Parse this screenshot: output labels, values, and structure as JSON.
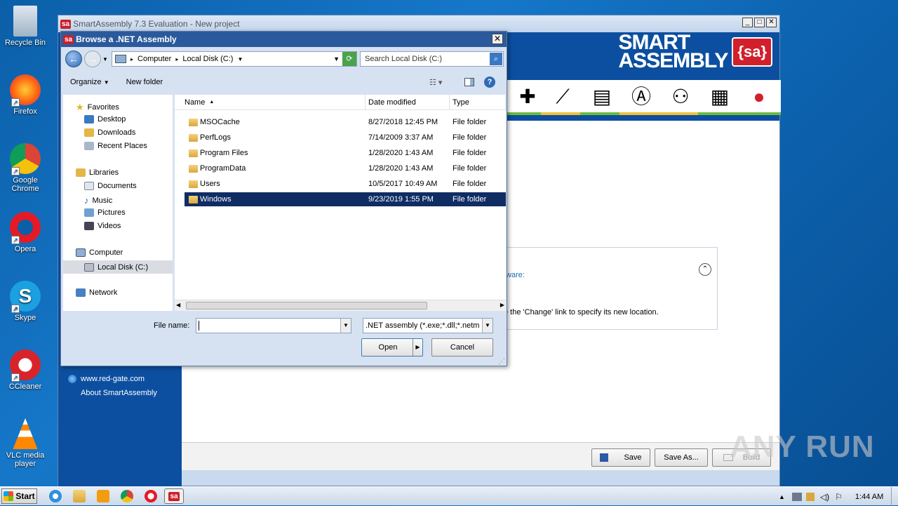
{
  "desktop": {
    "icons": [
      {
        "label": "Recycle Bin"
      },
      {
        "label": "Firefox"
      },
      {
        "label": "Google Chrome"
      },
      {
        "label": "Opera"
      },
      {
        "label": "Skype"
      },
      {
        "label": "CCleaner"
      },
      {
        "label": "VLC media player"
      }
    ]
  },
  "app": {
    "title": "SmartAssembly 7.3 Evaluation - New project",
    "logo_line1": "SMART",
    "logo_line2": "ASSEMBLY",
    "logo_badge": "{sa}",
    "left_links": [
      "www.red-gate.com",
      "About SmartAssembly"
    ],
    "panel_text1": "tware:",
    "panel_text2": "e the 'Change' link to specify its new location.",
    "buttons": {
      "save": "Save",
      "save_as": "Save As...",
      "build": "Build"
    }
  },
  "dialog": {
    "title": "Browse a .NET Assembly",
    "breadcrumb": [
      "Computer",
      "Local Disk (C:)"
    ],
    "search_placeholder": "Search Local Disk (C:)",
    "toolbar": {
      "organize": "Organize",
      "new_folder": "New folder"
    },
    "nav": {
      "favorites": "Favorites",
      "favorites_items": [
        "Desktop",
        "Downloads",
        "Recent Places"
      ],
      "libraries": "Libraries",
      "libraries_items": [
        "Documents",
        "Music",
        "Pictures",
        "Videos"
      ],
      "computer": "Computer",
      "computer_items": [
        "Local Disk (C:)"
      ],
      "network": "Network"
    },
    "columns": {
      "name": "Name",
      "date": "Date modified",
      "type": "Type"
    },
    "files": [
      {
        "name": "MSOCache",
        "date": "8/27/2018 12:45 PM",
        "type": "File folder"
      },
      {
        "name": "PerfLogs",
        "date": "7/14/2009 3:37 AM",
        "type": "File folder"
      },
      {
        "name": "Program Files",
        "date": "1/28/2020 1:43 AM",
        "type": "File folder"
      },
      {
        "name": "ProgramData",
        "date": "1/28/2020 1:43 AM",
        "type": "File folder"
      },
      {
        "name": "Users",
        "date": "10/5/2017 10:49 AM",
        "type": "File folder"
      },
      {
        "name": "Windows",
        "date": "9/23/2019 1:55 PM",
        "type": "File folder"
      }
    ],
    "filename_label": "File name:",
    "filename_value": "",
    "filter": ".NET assembly (*.exe;*.dll;*.netm",
    "open": "Open",
    "cancel": "Cancel"
  },
  "taskbar": {
    "start": "Start",
    "time": "1:44 AM"
  },
  "watermark": "ANY RUN"
}
